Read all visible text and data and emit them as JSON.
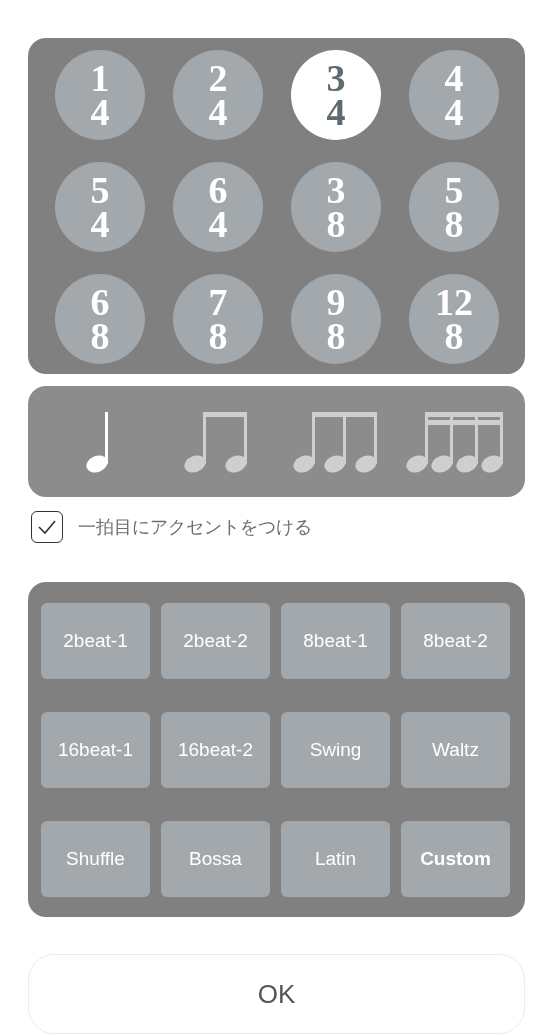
{
  "time_signatures": [
    {
      "numerator": "1",
      "denominator": "4",
      "selected": false
    },
    {
      "numerator": "2",
      "denominator": "4",
      "selected": false
    },
    {
      "numerator": "3",
      "denominator": "4",
      "selected": true
    },
    {
      "numerator": "4",
      "denominator": "4",
      "selected": false
    },
    {
      "numerator": "5",
      "denominator": "4",
      "selected": false
    },
    {
      "numerator": "6",
      "denominator": "4",
      "selected": false
    },
    {
      "numerator": "3",
      "denominator": "8",
      "selected": false
    },
    {
      "numerator": "5",
      "denominator": "8",
      "selected": false
    },
    {
      "numerator": "6",
      "denominator": "8",
      "selected": false
    },
    {
      "numerator": "7",
      "denominator": "8",
      "selected": false
    },
    {
      "numerator": "9",
      "denominator": "8",
      "selected": false
    },
    {
      "numerator": "12",
      "denominator": "8",
      "selected": false
    }
  ],
  "subdivisions": [
    {
      "kind": "quarter",
      "selected": true
    },
    {
      "kind": "eighth",
      "selected": false
    },
    {
      "kind": "triplet",
      "selected": false
    },
    {
      "kind": "sixteenth",
      "selected": false
    }
  ],
  "accent_option": {
    "label": "一拍目にアクセントをつける",
    "checked": true
  },
  "rhythm_presets": [
    {
      "label": "2beat-1",
      "kind": "preset"
    },
    {
      "label": "2beat-2",
      "kind": "preset"
    },
    {
      "label": "8beat-1",
      "kind": "preset"
    },
    {
      "label": "8beat-2",
      "kind": "preset"
    },
    {
      "label": "16beat-1",
      "kind": "preset"
    },
    {
      "label": "16beat-2",
      "kind": "preset"
    },
    {
      "label": "Swing",
      "kind": "preset"
    },
    {
      "label": "Waltz",
      "kind": "preset"
    },
    {
      "label": "Shuffle",
      "kind": "preset"
    },
    {
      "label": "Bossa",
      "kind": "preset"
    },
    {
      "label": "Latin",
      "kind": "preset"
    },
    {
      "label": "Custom",
      "kind": "custom"
    }
  ],
  "ok_button": {
    "label": "OK"
  }
}
